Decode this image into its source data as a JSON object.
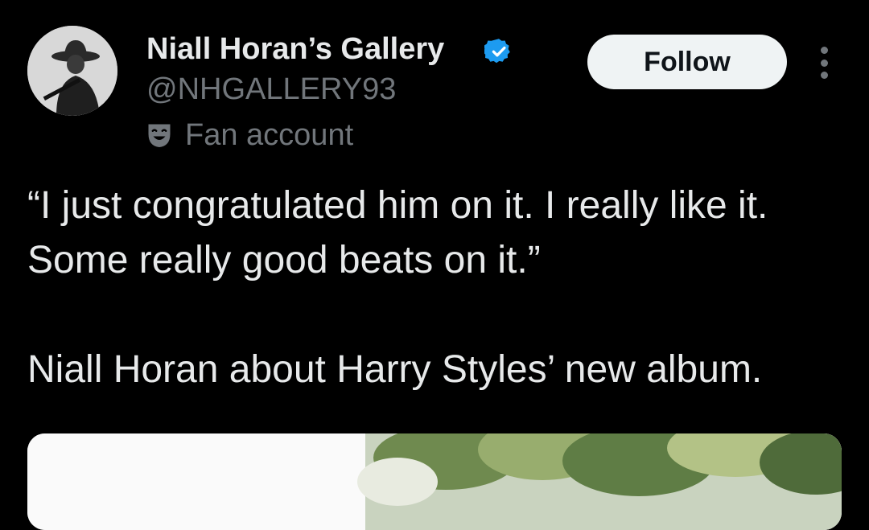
{
  "account": {
    "display_name": "Niall Horan’s Gallery",
    "handle": "@NHGALLERY93",
    "label": "Fan account",
    "verified_color": "#1d9bf0",
    "avatar_icon": "cowboy-silhouette"
  },
  "actions": {
    "follow_label": "Follow",
    "more_icon": "vertical-ellipsis"
  },
  "tweet": {
    "quote": "“I just congratulated him on it. I really like it. Some really good beats on it.”",
    "caption": "Niall Horan about Harry Styles’ new album."
  },
  "colors": {
    "background": "#000000",
    "text": "#e7e9ea",
    "secondary": "#71767b",
    "button_bg": "#eff3f4"
  }
}
